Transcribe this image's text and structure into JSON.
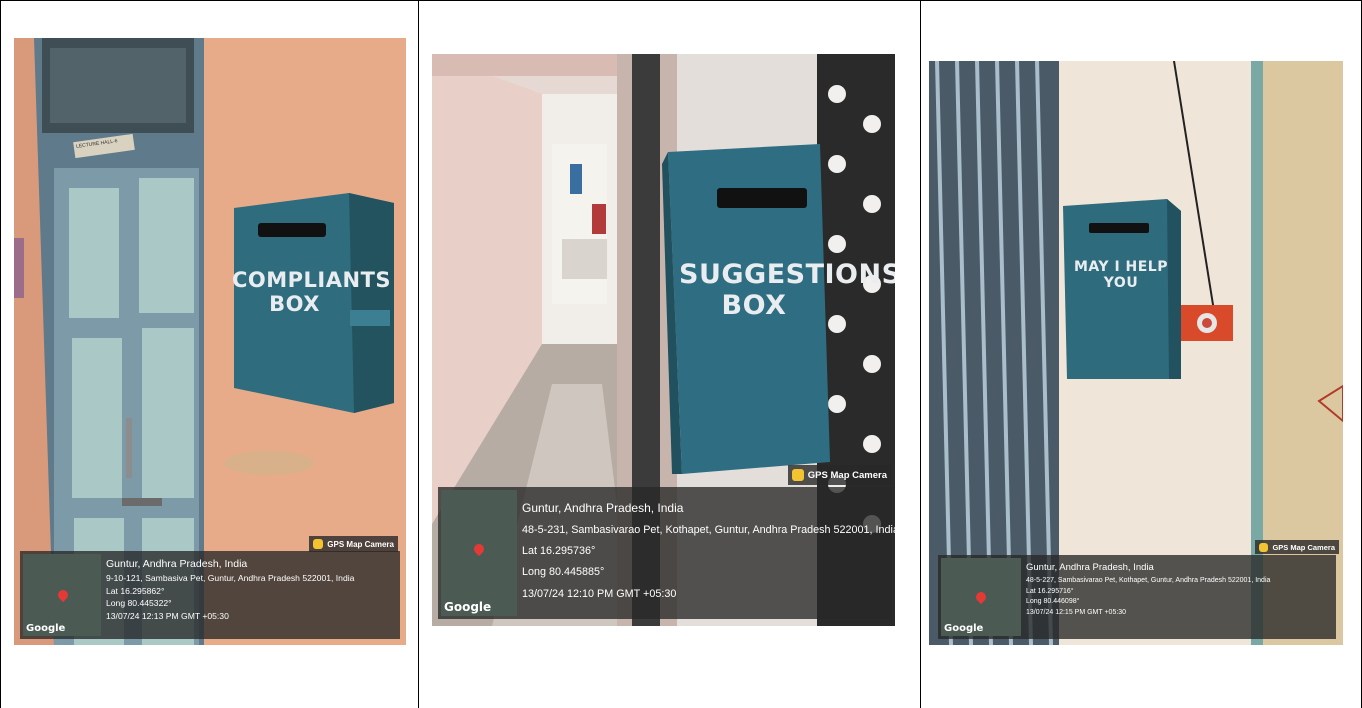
{
  "photos": [
    {
      "box_label_line1": "COMPLIANTS",
      "box_label_line2": "BOX",
      "sign_text": "LECTURE HALL-6",
      "tag": "GPS Map Camera",
      "place": "Guntur, Andhra Pradesh, India",
      "address": "9-10-121, Sambasiva Pet, Guntur, Andhra Pradesh 522001, India",
      "lat": "Lat 16.295862°",
      "long": "Long 80.445322°",
      "datetime": "13/07/24 12:13 PM GMT +05:30",
      "map_label": "Google"
    },
    {
      "box_label_line1": "SUGGESTIONS",
      "box_label_line2": "BOX",
      "tag": "GPS Map Camera",
      "place": "Guntur, Andhra Pradesh, India",
      "address": "48-5-231, Sambasivarao Pet, Kothapet, Guntur, Andhra Pradesh 522001, India",
      "lat": "Lat 16.295736°",
      "long": "Long 80.445885°",
      "datetime": "13/07/24 12:10 PM GMT +05:30",
      "map_label": "Google"
    },
    {
      "box_label_line1": "MAY I HELP YOU",
      "tag": "GPS Map Camera",
      "place": "Guntur, Andhra Pradesh, India",
      "address": "48-5-227, Sambasivarao Pet, Kothapet, Guntur, Andhra Pradesh 522001, India",
      "lat": "Lat 16.295716°",
      "long": "Long 80.446098°",
      "datetime": "13/07/24 12:15 PM GMT +05:30",
      "map_label": "Google"
    }
  ]
}
